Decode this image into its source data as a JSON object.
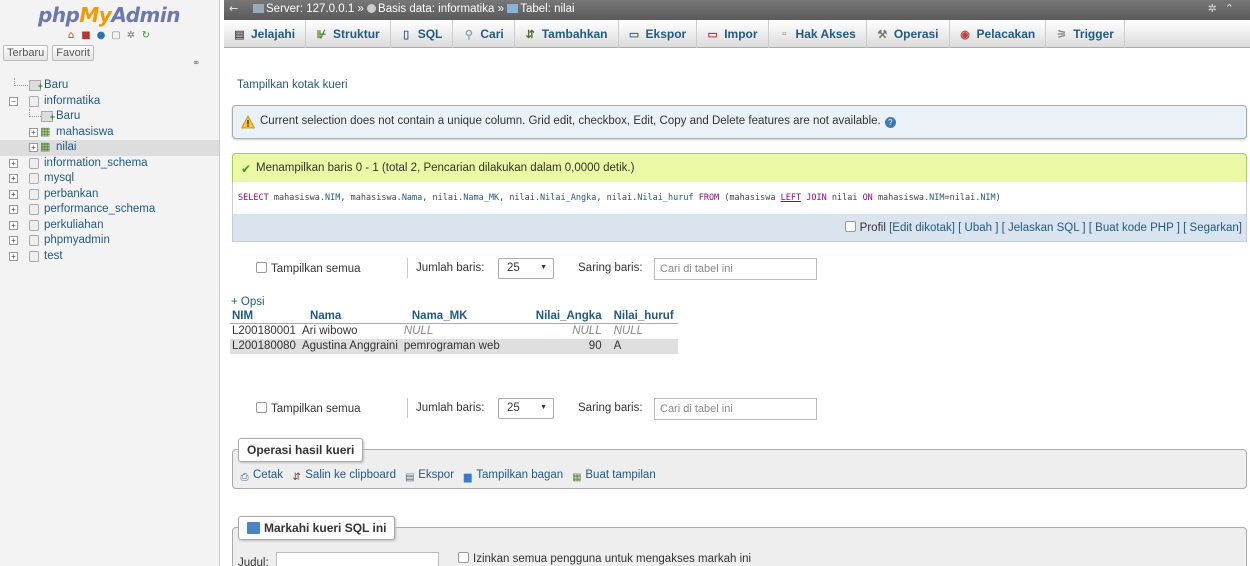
{
  "nav": {
    "logo_php": "php",
    "logo_my": "My",
    "logo_admin": "Admin",
    "icons": [
      "home-icon",
      "logout-icon",
      "docs-icon",
      "help-icon",
      "settings-icon",
      "reload-icon"
    ],
    "recent_label": "Terbaru",
    "favorites_label": "Favorit",
    "tree": [
      {
        "label": "Baru",
        "depth": 0,
        "type": "new"
      },
      {
        "label": "informatika",
        "depth": 0,
        "type": "db",
        "expanded": true
      },
      {
        "label": "Baru",
        "depth": 1,
        "type": "new"
      },
      {
        "label": "mahasiswa",
        "depth": 1,
        "type": "table"
      },
      {
        "label": "nilai",
        "depth": 1,
        "type": "table",
        "selected": true
      },
      {
        "label": "information_schema",
        "depth": 0,
        "type": "db"
      },
      {
        "label": "mysql",
        "depth": 0,
        "type": "db"
      },
      {
        "label": "perbankan",
        "depth": 0,
        "type": "db"
      },
      {
        "label": "performance_schema",
        "depth": 0,
        "type": "db"
      },
      {
        "label": "perkuliahan",
        "depth": 0,
        "type": "db"
      },
      {
        "label": "phpmyadmin",
        "depth": 0,
        "type": "db"
      },
      {
        "label": "test",
        "depth": 0,
        "type": "db"
      }
    ]
  },
  "breadcrumb": {
    "server": "Server: 127.0.0.1",
    "database": "Basis data: informatika",
    "table": "Tabel: nilai",
    "separator": "»"
  },
  "tabs": [
    {
      "label": "Jelajahi",
      "icon": "browse-icon"
    },
    {
      "label": "Struktur",
      "icon": "structure-icon"
    },
    {
      "label": "SQL",
      "icon": "sql-icon"
    },
    {
      "label": "Cari",
      "icon": "search-icon"
    },
    {
      "label": "Tambahkan",
      "icon": "insert-icon"
    },
    {
      "label": "Ekspor",
      "icon": "export-icon"
    },
    {
      "label": "Impor",
      "icon": "import-icon"
    },
    {
      "label": "Hak Akses",
      "icon": "privileges-icon"
    },
    {
      "label": "Operasi",
      "icon": "operations-icon"
    },
    {
      "label": "Pelacakan",
      "icon": "tracking-icon"
    },
    {
      "label": "Trigger",
      "icon": "trigger-icon"
    }
  ],
  "content": {
    "show_query_box": "Tampilkan kotak kueri",
    "notice": "Current selection does not contain a unique column. Grid edit, checkbox, Edit, Copy and Delete features are not available.",
    "success": "Menampilkan baris 0 - 1 (total 2, Pencarian dilakukan dalam 0,0000 detik.)",
    "sql": {
      "select": "SELECT",
      "c1": "mahasiswa.",
      "c1f": "NIM",
      "c2": ", mahasiswa.",
      "c2f": "Nama",
      "c3": ", nilai.",
      "c3f": "Nama_MK",
      "c4": ", nilai.",
      "c4f": "Nilai_Angka",
      "c5": ", nilai.",
      "c5f": "Nilai_huruf",
      "from": "FROM",
      "p1": "(mahasiswa",
      "left": "LEFT",
      "join": "JOIN",
      "p2": "nilai",
      "on": "ON",
      "p3": "mahasiswa.",
      "p3f": "NIM",
      "p4": "=nilai.",
      "p4f": "NIM",
      "p5": ")"
    },
    "sql_actions": {
      "profil": "Profil",
      "edit_inline": "[Edit dikotak]",
      "edit": "[ Ubah ]",
      "explain": "[ Jelaskan SQL ]",
      "php": "[ Buat kode PHP ]",
      "refresh": "[ Segarkan]"
    },
    "navigation": {
      "show_all": "Tampilkan semua",
      "rows_label": "Jumlah baris:",
      "rows_value": "25",
      "filter_label": "Saring baris:",
      "filter_placeholder": "Cari di tabel ini"
    },
    "options_link": "+ Opsi",
    "table": {
      "columns": [
        "NIM",
        "Nama",
        "Nama_MK",
        "Nilai_Angka",
        "Nilai_huruf"
      ],
      "rows": [
        [
          "L200180001",
          "Ari wibowo",
          "NULL",
          "NULL",
          "NULL"
        ],
        [
          "L200180080",
          "Agustina Anggraini",
          "pemrograman web",
          "90",
          "A"
        ]
      ]
    },
    "query_ops": {
      "legend": "Operasi hasil kueri",
      "print": "Cetak",
      "copy": "Salin ke clipboard",
      "export": "Ekspor",
      "chart": "Tampilkan bagan",
      "view": "Buat tampilan"
    },
    "bookmark": {
      "legend": "Markahi kueri SQL ini",
      "label": "Judul:",
      "public_label": "Izinkan semua pengguna untuk mengakses markah ini"
    }
  }
}
